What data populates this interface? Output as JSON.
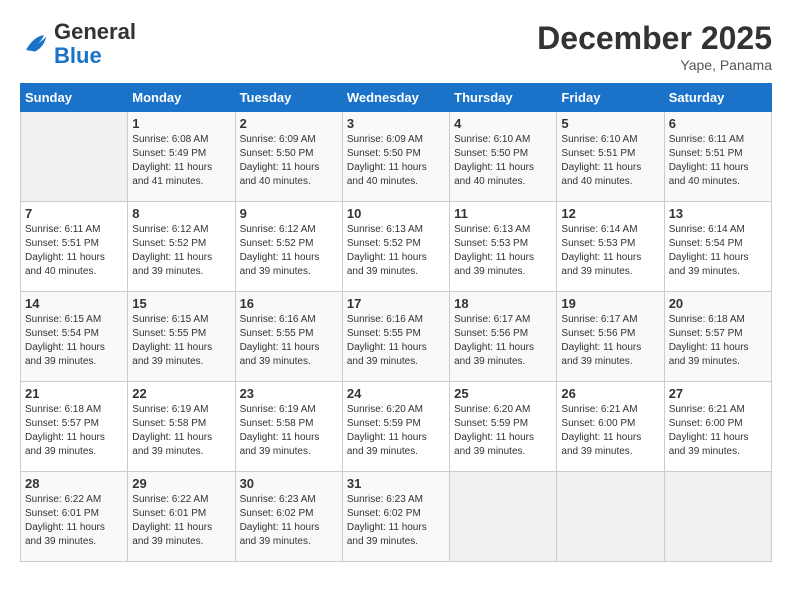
{
  "header": {
    "logo_text_general": "General",
    "logo_text_blue": "Blue",
    "month_title": "December 2025",
    "location": "Yape, Panama"
  },
  "days_of_week": [
    "Sunday",
    "Monday",
    "Tuesday",
    "Wednesday",
    "Thursday",
    "Friday",
    "Saturday"
  ],
  "weeks": [
    [
      {
        "day": "",
        "empty": true
      },
      {
        "day": "1",
        "sunrise": "6:08 AM",
        "sunset": "5:49 PM",
        "daylight": "11 hours and 41 minutes."
      },
      {
        "day": "2",
        "sunrise": "6:09 AM",
        "sunset": "5:50 PM",
        "daylight": "11 hours and 40 minutes."
      },
      {
        "day": "3",
        "sunrise": "6:09 AM",
        "sunset": "5:50 PM",
        "daylight": "11 hours and 40 minutes."
      },
      {
        "day": "4",
        "sunrise": "6:10 AM",
        "sunset": "5:50 PM",
        "daylight": "11 hours and 40 minutes."
      },
      {
        "day": "5",
        "sunrise": "6:10 AM",
        "sunset": "5:51 PM",
        "daylight": "11 hours and 40 minutes."
      },
      {
        "day": "6",
        "sunrise": "6:11 AM",
        "sunset": "5:51 PM",
        "daylight": "11 hours and 40 minutes."
      }
    ],
    [
      {
        "day": "7",
        "sunrise": "6:11 AM",
        "sunset": "5:51 PM",
        "daylight": "11 hours and 40 minutes."
      },
      {
        "day": "8",
        "sunrise": "6:12 AM",
        "sunset": "5:52 PM",
        "daylight": "11 hours and 39 minutes."
      },
      {
        "day": "9",
        "sunrise": "6:12 AM",
        "sunset": "5:52 PM",
        "daylight": "11 hours and 39 minutes."
      },
      {
        "day": "10",
        "sunrise": "6:13 AM",
        "sunset": "5:52 PM",
        "daylight": "11 hours and 39 minutes."
      },
      {
        "day": "11",
        "sunrise": "6:13 AM",
        "sunset": "5:53 PM",
        "daylight": "11 hours and 39 minutes."
      },
      {
        "day": "12",
        "sunrise": "6:14 AM",
        "sunset": "5:53 PM",
        "daylight": "11 hours and 39 minutes."
      },
      {
        "day": "13",
        "sunrise": "6:14 AM",
        "sunset": "5:54 PM",
        "daylight": "11 hours and 39 minutes."
      }
    ],
    [
      {
        "day": "14",
        "sunrise": "6:15 AM",
        "sunset": "5:54 PM",
        "daylight": "11 hours and 39 minutes."
      },
      {
        "day": "15",
        "sunrise": "6:15 AM",
        "sunset": "5:55 PM",
        "daylight": "11 hours and 39 minutes."
      },
      {
        "day": "16",
        "sunrise": "6:16 AM",
        "sunset": "5:55 PM",
        "daylight": "11 hours and 39 minutes."
      },
      {
        "day": "17",
        "sunrise": "6:16 AM",
        "sunset": "5:55 PM",
        "daylight": "11 hours and 39 minutes."
      },
      {
        "day": "18",
        "sunrise": "6:17 AM",
        "sunset": "5:56 PM",
        "daylight": "11 hours and 39 minutes."
      },
      {
        "day": "19",
        "sunrise": "6:17 AM",
        "sunset": "5:56 PM",
        "daylight": "11 hours and 39 minutes."
      },
      {
        "day": "20",
        "sunrise": "6:18 AM",
        "sunset": "5:57 PM",
        "daylight": "11 hours and 39 minutes."
      }
    ],
    [
      {
        "day": "21",
        "sunrise": "6:18 AM",
        "sunset": "5:57 PM",
        "daylight": "11 hours and 39 minutes."
      },
      {
        "day": "22",
        "sunrise": "6:19 AM",
        "sunset": "5:58 PM",
        "daylight": "11 hours and 39 minutes."
      },
      {
        "day": "23",
        "sunrise": "6:19 AM",
        "sunset": "5:58 PM",
        "daylight": "11 hours and 39 minutes."
      },
      {
        "day": "24",
        "sunrise": "6:20 AM",
        "sunset": "5:59 PM",
        "daylight": "11 hours and 39 minutes."
      },
      {
        "day": "25",
        "sunrise": "6:20 AM",
        "sunset": "5:59 PM",
        "daylight": "11 hours and 39 minutes."
      },
      {
        "day": "26",
        "sunrise": "6:21 AM",
        "sunset": "6:00 PM",
        "daylight": "11 hours and 39 minutes."
      },
      {
        "day": "27",
        "sunrise": "6:21 AM",
        "sunset": "6:00 PM",
        "daylight": "11 hours and 39 minutes."
      }
    ],
    [
      {
        "day": "28",
        "sunrise": "6:22 AM",
        "sunset": "6:01 PM",
        "daylight": "11 hours and 39 minutes."
      },
      {
        "day": "29",
        "sunrise": "6:22 AM",
        "sunset": "6:01 PM",
        "daylight": "11 hours and 39 minutes."
      },
      {
        "day": "30",
        "sunrise": "6:23 AM",
        "sunset": "6:02 PM",
        "daylight": "11 hours and 39 minutes."
      },
      {
        "day": "31",
        "sunrise": "6:23 AM",
        "sunset": "6:02 PM",
        "daylight": "11 hours and 39 minutes."
      },
      {
        "day": "",
        "empty": true
      },
      {
        "day": "",
        "empty": true
      },
      {
        "day": "",
        "empty": true
      }
    ]
  ],
  "labels": {
    "sunrise": "Sunrise:",
    "sunset": "Sunset:",
    "daylight": "Daylight:"
  }
}
